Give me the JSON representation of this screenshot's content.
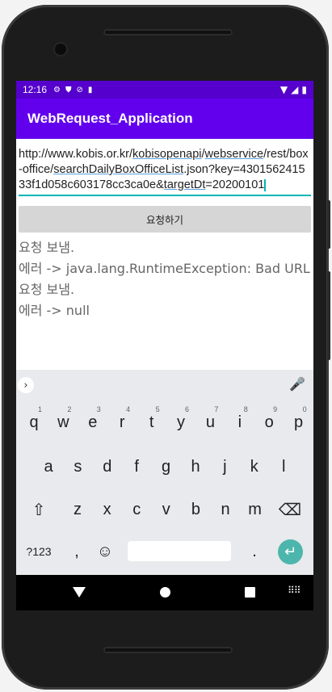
{
  "status_bar": {
    "time": "12:16",
    "icons": [
      "gear-icon",
      "shield-icon",
      "do-not-disturb-icon",
      "sd-card-icon"
    ],
    "right_icons": [
      "wifi-icon",
      "signal-icon",
      "battery-icon"
    ]
  },
  "app_bar": {
    "title": "WebRequest_Application"
  },
  "url_input": {
    "segments": [
      {
        "text": "http://www.kobis.or.kr/",
        "underline": false
      },
      {
        "text": "kobisopenapi",
        "underline": true
      },
      {
        "text": "/",
        "underline": false
      },
      {
        "text": "webservice",
        "underline": true
      },
      {
        "text": "/rest/box-office/",
        "underline": false
      },
      {
        "text": "searchDailyBoxOfficeList",
        "underline": true
      },
      {
        "text": ".json?key=430156241533f1d058c603178cc3ca0e&",
        "underline": false
      },
      {
        "text": "targetDt",
        "underline": true
      },
      {
        "text": "=20200101",
        "underline": false
      }
    ]
  },
  "request_button": {
    "label": "요청하기"
  },
  "log_lines": [
    "요청 보냄.",
    "에러 -> java.lang.RuntimeException: Bad URL",
    "요청 보냄.",
    "에러 -> null"
  ],
  "keyboard": {
    "row1": [
      {
        "k": "q",
        "n": "1"
      },
      {
        "k": "w",
        "n": "2"
      },
      {
        "k": "e",
        "n": "3"
      },
      {
        "k": "r",
        "n": "4"
      },
      {
        "k": "t",
        "n": "5"
      },
      {
        "k": "y",
        "n": "6"
      },
      {
        "k": "u",
        "n": "7"
      },
      {
        "k": "i",
        "n": "8"
      },
      {
        "k": "o",
        "n": "9"
      },
      {
        "k": "p",
        "n": "0"
      }
    ],
    "row2": [
      "a",
      "s",
      "d",
      "f",
      "g",
      "h",
      "j",
      "k",
      "l"
    ],
    "row3": [
      "z",
      "x",
      "c",
      "v",
      "b",
      "n",
      "m"
    ],
    "symbols_label": "?123",
    "comma": ",",
    "period": ".",
    "shift_icon": "⇧",
    "backspace_icon": "⌫",
    "emoji_icon": "☺",
    "enter_icon": "↵",
    "expand_icon": "›",
    "mic_icon": "🎤"
  },
  "colors": {
    "status_bar": "#5500cc",
    "app_bar": "#6200ee",
    "accent": "#00b5b5",
    "enter_key": "#4db6ac"
  }
}
